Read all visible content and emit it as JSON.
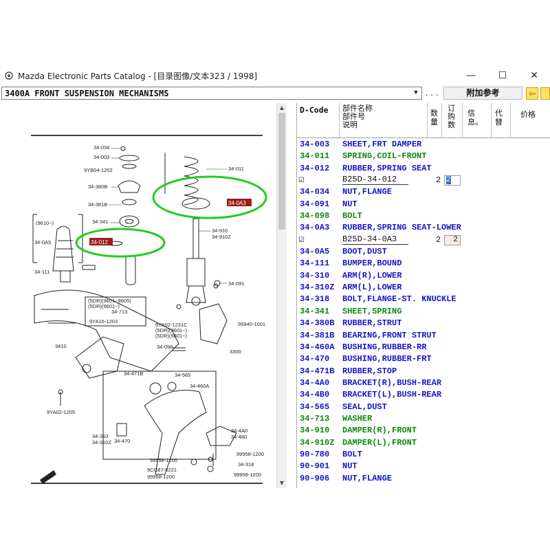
{
  "window": {
    "title": "Mazda Electronic Parts Catalog - [目录图像/文本323 / 1998]",
    "controls": [
      "—",
      "☐",
      "✕"
    ]
  },
  "toolbar": {
    "section": "3400A  FRONT SUSPENSION MECHANISMS",
    "ellipsis": ". . .",
    "ref_button": "附加参考",
    "nav_left": "⇦"
  },
  "diagram": {
    "labels": [
      "34-034",
      "34-003",
      "9YB04-1202",
      "34-380B",
      "34-381B",
      "34-341",
      "34-011",
      "34-910",
      "34-910Z",
      "34-091",
      "(9610~)",
      "34-0A5",
      "34-111",
      "(5DR)(9601~9605)",
      "(5DR)(9601~)",
      "34-713",
      "9YA16-1203",
      "9YA02-1231C",
      "(5DR)(9601~)",
      "(5DR)(9601~)",
      "34-098",
      "99940-1001",
      "3410",
      "3300",
      "34-471B",
      "34-565",
      "34-460A",
      "9YA02-1205",
      "34-310",
      "34-310Z",
      "34-470",
      "34-4A0",
      "34-480",
      "99958-1200",
      "99958-1200",
      "9CG87-0221",
      "99958-1200",
      "34-318",
      "99958-1200"
    ],
    "highlight_tags": [
      "34-0A3",
      "34-012"
    ]
  },
  "parts": {
    "headers": {
      "dcode": "D-Code",
      "names": [
        "部件名称",
        "部件号",
        "说明"
      ],
      "qty": [
        "数",
        "量"
      ],
      "order": [
        "订",
        "购",
        "数"
      ],
      "info": [
        "信",
        "息。"
      ],
      "replace": [
        "代",
        "替"
      ],
      "price": "价格"
    },
    "rows": [
      {
        "code": "34-003",
        "name": "SHEET,FRT DAMPER",
        "color": "blue"
      },
      {
        "code": "34-011",
        "name": "SPRING,COIL-FRONT",
        "color": "green"
      },
      {
        "code": "34-012",
        "name": "RUBBER,SPRING SEAT",
        "color": "blue"
      },
      {
        "sub": true,
        "check": "☑",
        "pn": "B25D-34-012",
        "qty": "2",
        "order": "2",
        "selected": true
      },
      {
        "code": "34-034",
        "name": "NUT,FLANGE",
        "color": "blue"
      },
      {
        "code": "34-091",
        "name": "NUT",
        "color": "blue"
      },
      {
        "code": "34-098",
        "name": "BOLT",
        "color": "green"
      },
      {
        "code": "34-0A3",
        "name": "RUBBER,SPRING SEAT-LOWER",
        "color": "blue"
      },
      {
        "sub": true,
        "check": "☑",
        "pn": "B25D-34-0A3",
        "qty": "2",
        "order": "2",
        "selected": false
      },
      {
        "code": "34-0A5",
        "name": "BOOT,DUST",
        "color": "blue"
      },
      {
        "code": "34-111",
        "name": "BUMPER,BOUND",
        "color": "blue"
      },
      {
        "code": "34-310",
        "name": "ARM(R),LOWER",
        "color": "blue"
      },
      {
        "code": "34-310Z",
        "name": "ARM(L),LOWER",
        "color": "blue"
      },
      {
        "code": "34-318",
        "name": "BOLT,FLANGE-ST. KNUCKLE",
        "color": "blue"
      },
      {
        "code": "34-341",
        "name": "SHEET,SPRING",
        "color": "green"
      },
      {
        "code": "34-380B",
        "name": "RUBBER,STRUT",
        "color": "blue"
      },
      {
        "code": "34-381B",
        "name": "BEARING,FRONT STRUT",
        "color": "blue"
      },
      {
        "code": "34-460A",
        "name": "BUSHING,RUBBER-RR",
        "color": "blue"
      },
      {
        "code": "34-470",
        "name": "BUSHING,RUBBER-FRT",
        "color": "blue"
      },
      {
        "code": "34-471B",
        "name": "RUBBER,STOP",
        "color": "blue"
      },
      {
        "code": "34-4A0",
        "name": "BRACKET(R),BUSH-REAR",
        "color": "blue"
      },
      {
        "code": "34-4B0",
        "name": "BRACKET(L),BUSH-REAR",
        "color": "blue"
      },
      {
        "code": "34-565",
        "name": "SEAL,DUST",
        "color": "blue"
      },
      {
        "code": "34-713",
        "name": "WASHER",
        "color": "green"
      },
      {
        "code": "34-910",
        "name": "DAMPER(R),FRONT",
        "color": "green"
      },
      {
        "code": "34-910Z",
        "name": "DAMPER(L),FRONT",
        "color": "green"
      },
      {
        "code": "90-780",
        "name": "BOLT",
        "color": "blue"
      },
      {
        "code": "90-901",
        "name": "NUT",
        "color": "blue"
      },
      {
        "code": "90-906",
        "name": "NUT,FLANGE",
        "color": "blue"
      }
    ]
  },
  "colors": {
    "code_blue": "#1515c8",
    "code_green": "#0a8a0a",
    "highlight_ring": "#22cc22",
    "tag_red": "#9a1c1c"
  }
}
